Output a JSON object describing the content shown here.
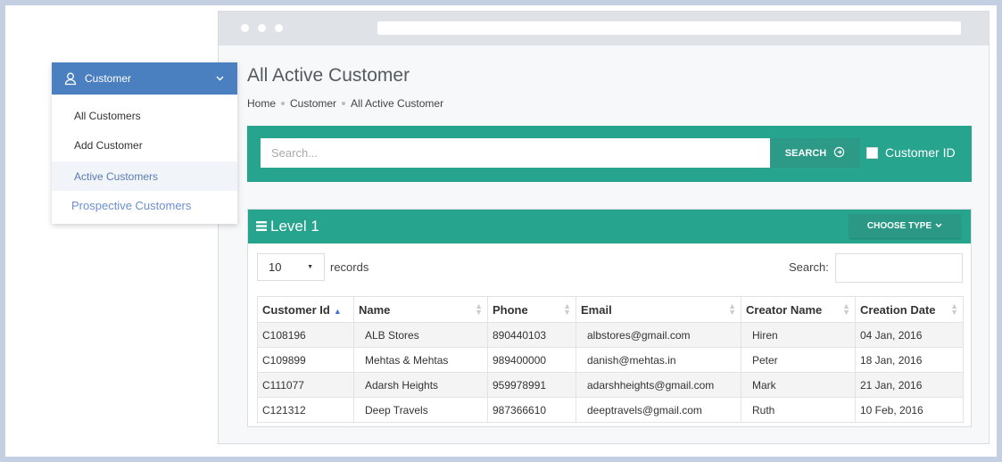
{
  "page": {
    "title": "All Active Customer",
    "breadcrumb": [
      "Home",
      "Customer",
      "All Active Customer"
    ]
  },
  "search": {
    "placeholder": "Search...",
    "button_label": "SEARCH",
    "checkbox_label": "Customer ID"
  },
  "panel": {
    "title": "Level 1",
    "choose_type_label": "CHOOSE TYPE"
  },
  "table_controls": {
    "page_length": "10",
    "records_label": "records",
    "search_label": "Search:"
  },
  "table": {
    "columns": [
      "Customer Id",
      "Name",
      "Phone",
      "Email",
      "Creator Name",
      "Creation Date"
    ],
    "rows": [
      [
        "C108196",
        "ALB Stores",
        "890440103",
        "albstores@gmail.com",
        "Hiren",
        "04 Jan, 2016"
      ],
      [
        "C109899",
        "Mehtas & Mehtas",
        "989400000",
        "danish@mehtas.in",
        "Peter",
        "18 Jan, 2016"
      ],
      [
        "C111077",
        "Adarsh Heights",
        "959978991",
        "adarshheights@gmail.com",
        "Mark",
        "21 Jan, 2016"
      ],
      [
        "C121312",
        "Deep Travels",
        "987366610",
        "deeptravels@gmail.com",
        "Ruth",
        "10 Feb, 2016"
      ]
    ]
  },
  "menu": {
    "header_label": "Customer",
    "items": [
      "All Customers",
      "Add Customer",
      "Active Customers",
      "Prospective Customers"
    ]
  },
  "colors": {
    "teal": "#27a48e",
    "menu_blue": "#4a7fc0",
    "link_blue": "#6b8fd0"
  },
  "icons": [
    "user-icon",
    "chevron-down-icon",
    "arrow-circle-icon",
    "list-icon",
    "caret-down-icon",
    "sort-icon",
    "sort-asc-icon"
  ]
}
